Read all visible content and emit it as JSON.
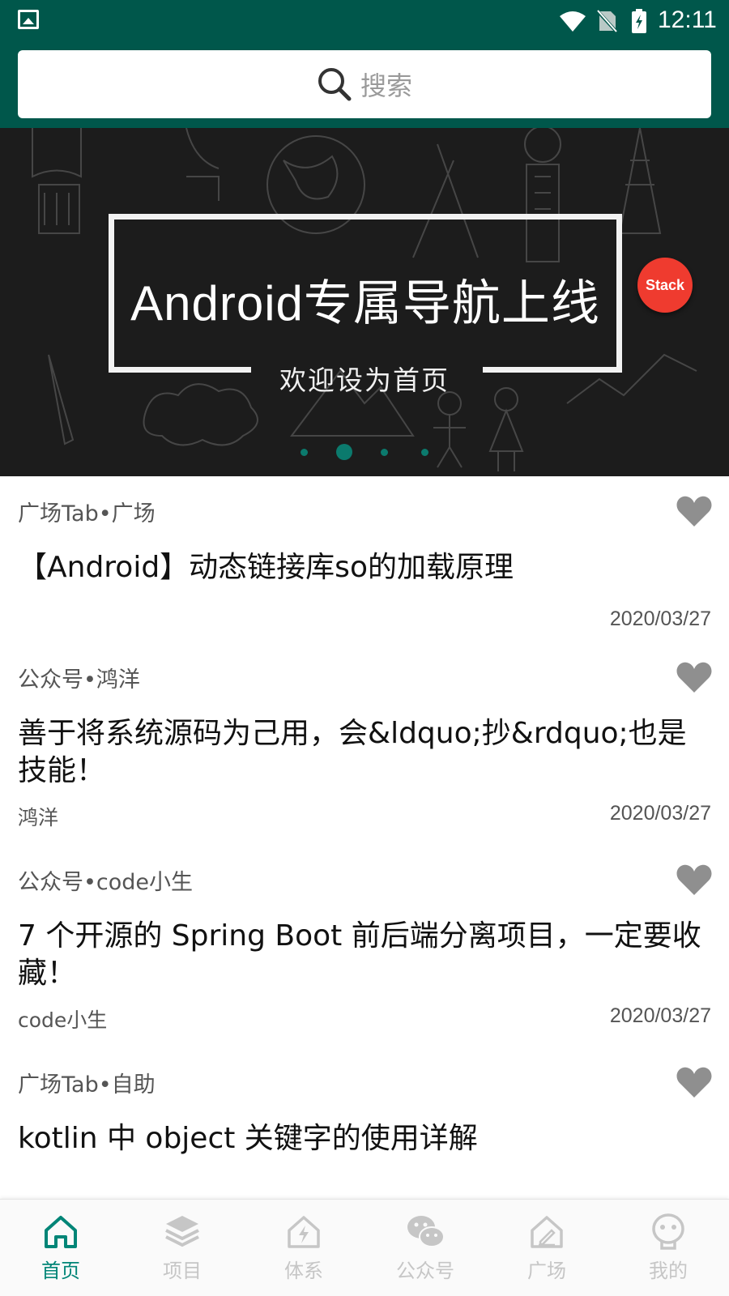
{
  "status_bar": {
    "time": "12:11",
    "icons": [
      "gallery-icon",
      "wifi-icon",
      "no-sim-icon",
      "battery-charging-icon"
    ]
  },
  "search": {
    "placeholder": "搜索",
    "icon": "search-icon"
  },
  "banner": {
    "title": "Android专属导航上线",
    "subtitle": "欢迎设为首页",
    "badge": "Stack",
    "page_count": 4,
    "active_page": 2
  },
  "articles": [
    {
      "meta": "广场Tab•广场",
      "title": "【Android】动态链接库so的加载原理",
      "author": "",
      "date": "2020/03/27",
      "favorite_icon": "heart-icon"
    },
    {
      "meta": "公众号•鸿洋",
      "title": "善于将系统源码为己用，会&ldquo;抄&rdquo;也是技能！",
      "author": "鸿洋",
      "date": "2020/03/27",
      "favorite_icon": "heart-icon"
    },
    {
      "meta": "公众号•code小生",
      "title": "7 个开源的 Spring Boot 前后端分离项目，一定要收藏！",
      "author": "code小生",
      "date": "2020/03/27",
      "favorite_icon": "heart-icon"
    },
    {
      "meta": "广场Tab•自助",
      "title": "kotlin 中 object 关键字的使用详解",
      "author": "",
      "date": "",
      "favorite_icon": "heart-icon"
    }
  ],
  "bottom_nav": [
    {
      "label": "首页",
      "icon": "home-icon",
      "active": true
    },
    {
      "label": "项目",
      "icon": "layers-icon",
      "active": false
    },
    {
      "label": "体系",
      "icon": "system-icon",
      "active": false
    },
    {
      "label": "公众号",
      "icon": "wechat-icon",
      "active": false
    },
    {
      "label": "广场",
      "icon": "square-icon",
      "active": false
    },
    {
      "label": "我的",
      "icon": "profile-icon",
      "active": false
    }
  ],
  "colors": {
    "primary_dark": "#00574b",
    "accent": "#008577",
    "nav_inactive": "#c6c6c6",
    "badge_red": "#ef3b2f",
    "heart_gray": "#8f8f8f"
  }
}
